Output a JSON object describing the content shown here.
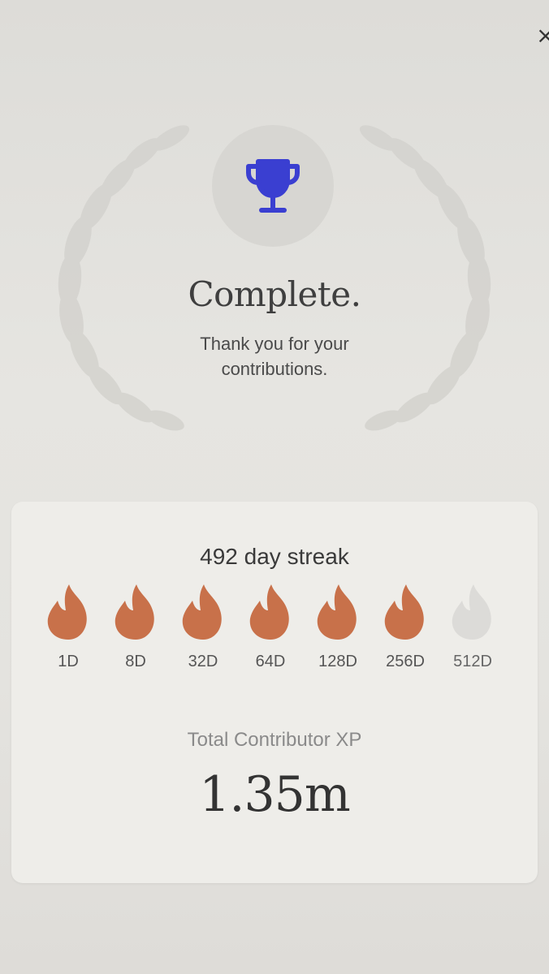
{
  "header": {
    "close_label": "×"
  },
  "hero": {
    "icon": "trophy-icon",
    "title": "Complete.",
    "subtitle": "Thank you for your contributions.",
    "accent_color": "#3a3fd1"
  },
  "streak": {
    "label": "492 day streak",
    "active_color": "#c8714a",
    "inactive_color": "#dcdbd8",
    "milestones": [
      {
        "label": "1D",
        "achieved": true
      },
      {
        "label": "8D",
        "achieved": true
      },
      {
        "label": "32D",
        "achieved": true
      },
      {
        "label": "64D",
        "achieved": true
      },
      {
        "label": "128D",
        "achieved": true
      },
      {
        "label": "256D",
        "achieved": true
      },
      {
        "label": "512D",
        "achieved": false
      }
    ]
  },
  "xp": {
    "label": "Total Contributor XP",
    "value": "1.35m"
  }
}
